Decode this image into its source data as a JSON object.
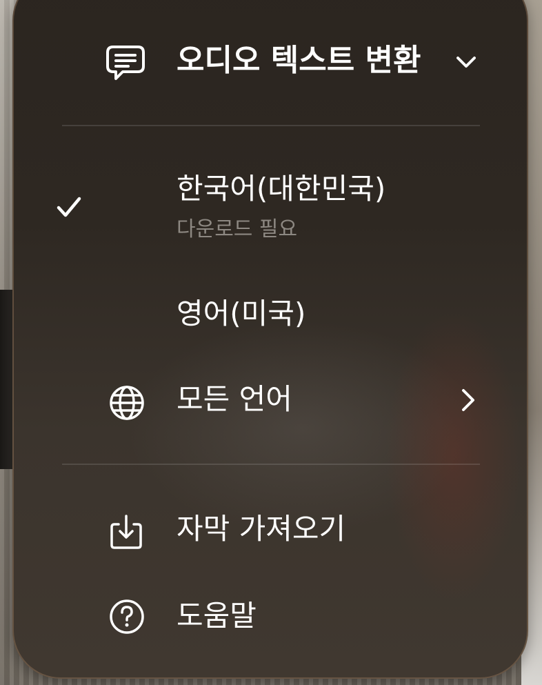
{
  "header": {
    "title": "오디오 텍스트 변환",
    "icon": "message-text-icon"
  },
  "languages": {
    "korean": {
      "label": "한국어(대한민국)",
      "sublabel": "다운로드 필요",
      "selected": true
    },
    "english": {
      "label": "영어(미국)"
    },
    "all": {
      "label": "모든 언어",
      "icon": "globe-icon"
    }
  },
  "actions": {
    "import": {
      "label": "자막 가져오기",
      "icon": "download-tray-icon"
    },
    "help": {
      "label": "도움말",
      "icon": "help-circle-icon"
    }
  },
  "colors": {
    "panel": "#2e2822",
    "text": "#ffffff",
    "subtext": "#8d8882",
    "divider": "#ffffff1f"
  }
}
